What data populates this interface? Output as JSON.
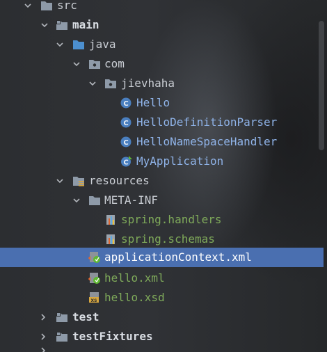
{
  "tree": {
    "src": "src",
    "main": "main",
    "java": "java",
    "com": "com",
    "jievhaha": "jievhaha",
    "Hello": "Hello",
    "HelloDefinitionParser": "HelloDefinitionParser",
    "HelloNameSpaceHandler": "HelloNameSpaceHandler",
    "MyApplication": "MyApplication",
    "resources": "resources",
    "meta_inf": "META-INF",
    "spring_handlers": "spring.handlers",
    "spring_schemas": "spring.schemas",
    "applicationContext": "applicationContext.xml",
    "hello_xml": "hello.xml",
    "hello_xsd": "hello.xsd",
    "test": "test",
    "testFixtures": "testFixtures"
  },
  "colors": {
    "selection": "#4a6fb0",
    "java_class": "#8fb3e8",
    "resource_file": "#7faa5a",
    "folder": "#8e9aa8",
    "source_folder": "#4c8fcf"
  },
  "selected_item": "applicationContext.xml"
}
